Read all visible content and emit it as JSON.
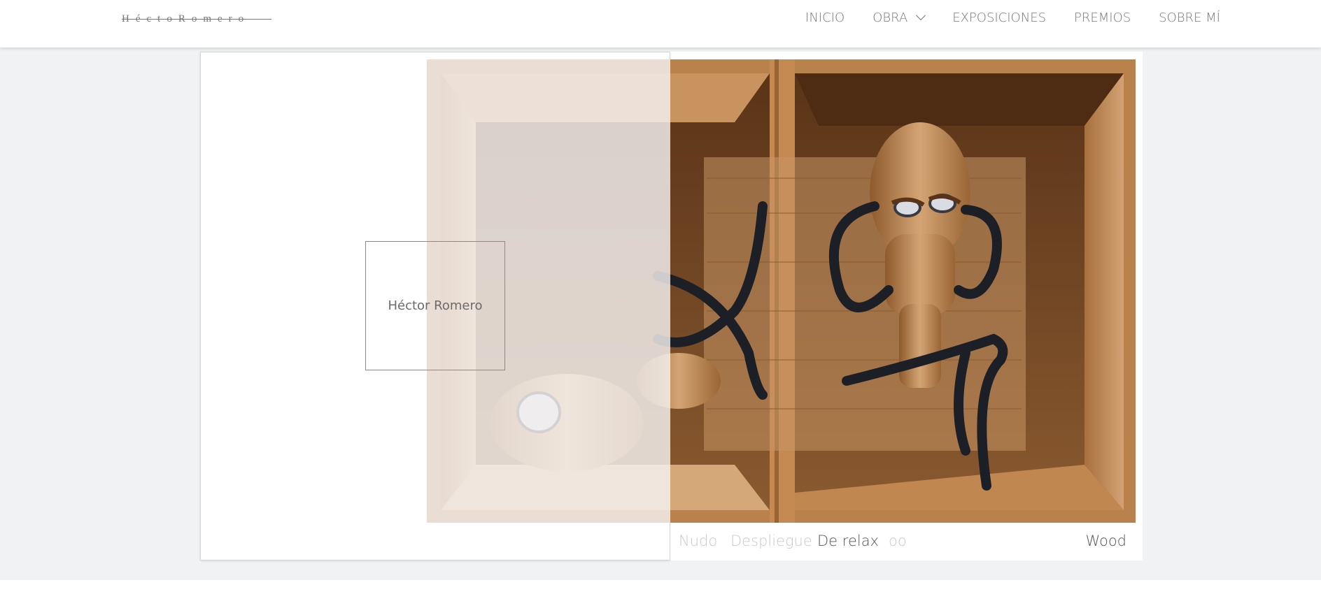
{
  "header": {
    "logo_text": "HéctoRomero",
    "nav": [
      {
        "label": "INICIO"
      },
      {
        "label": "OBRA"
      },
      {
        "label": "EXPOSICIONES"
      },
      {
        "label": "PREMIOS"
      },
      {
        "label": "SOBRE MÍ"
      }
    ]
  },
  "gallery": {
    "artist_name": "Héctor Romero",
    "captions": [
      {
        "label": "Nudo",
        "state": "dim"
      },
      {
        "label": "Despliegue",
        "state": "dim"
      },
      {
        "label": "De relax",
        "state": "active"
      },
      {
        "label": "oo",
        "state": "dim"
      }
    ],
    "series": "Wood"
  },
  "colors": {
    "accent_text": "#555555",
    "dim_text": "#c9c9c9",
    "band": "#f1f2f4",
    "wood_dark": "#6e4220",
    "wood_light": "#c99a66"
  }
}
